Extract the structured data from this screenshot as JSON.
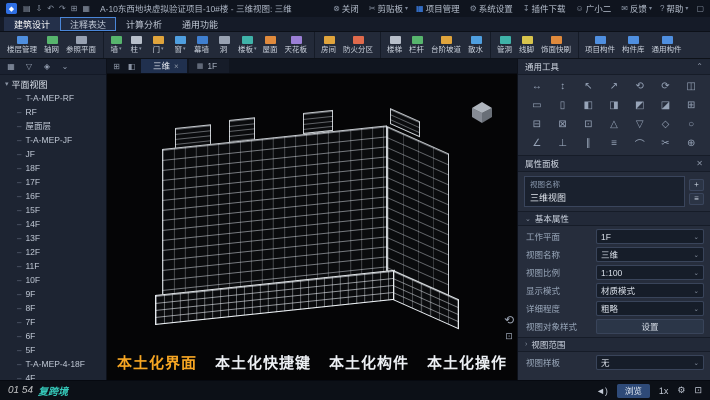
{
  "titlebar": {
    "logo_glyph": "◆",
    "quick_icons": [
      "▤",
      "⇩",
      "↶",
      "↷",
      "⊞",
      "▦"
    ],
    "title": "A-10东西地块虚拟验证项目-10#楼 - 三维视图: 三维",
    "right_items": [
      {
        "icon": "⊗",
        "label": "关闭",
        "arrow": ""
      },
      {
        "icon": "✂",
        "label": "剪贴板",
        "arrow": "▾"
      },
      {
        "icon": "▦",
        "label": "项目管理",
        "arrow": "",
        "icon_color": "#3f8cff"
      },
      {
        "icon": "⚙",
        "label": "系统设置",
        "arrow": ""
      },
      {
        "icon": "↧",
        "label": "插件下载",
        "arrow": ""
      },
      {
        "icon": "☺",
        "label": "广小二",
        "arrow": ""
      },
      {
        "icon": "✉",
        "label": "反馈",
        "arrow": "▾"
      },
      {
        "icon": "?",
        "label": "帮助",
        "arrow": "▾"
      }
    ],
    "window_glyph": "▢"
  },
  "menubar": {
    "tabs": [
      {
        "label": "建筑设计",
        "active": true
      },
      {
        "label": "注释表达",
        "hover": true
      },
      {
        "label": "计算分析"
      },
      {
        "label": "通用功能"
      }
    ]
  },
  "ribbon": {
    "tools": [
      {
        "label": "楼层管理",
        "color": "#4f8fe0"
      },
      {
        "label": "轴网",
        "color": "#57b56d"
      },
      {
        "label": "参照平面",
        "color": "#98a1b1"
      },
      {
        "label": "墙",
        "color": "#57b56d",
        "arrow": "▾",
        "sep": true
      },
      {
        "label": "柱",
        "color": "#b8bfca",
        "arrow": "▾"
      },
      {
        "label": "门",
        "color": "#e0a43c",
        "arrow": "▾"
      },
      {
        "label": "窗",
        "color": "#4f9fe0",
        "arrow": "▾"
      },
      {
        "label": "幕墙",
        "color": "#3f7fd0"
      },
      {
        "label": "洞",
        "color": "#98a1b1"
      },
      {
        "label": "楼板",
        "color": "#3fb3a9",
        "arrow": "▾"
      },
      {
        "label": "屋面",
        "color": "#e08a3c"
      },
      {
        "label": "天花板",
        "color": "#9b7fd6"
      },
      {
        "label": "房间",
        "color": "#e0a43c",
        "sep": true
      },
      {
        "label": "防火分区",
        "color": "#e06a4c"
      },
      {
        "label": "楼梯",
        "color": "#b8bfca",
        "sep": true
      },
      {
        "label": "栏杆",
        "color": "#57b56d"
      },
      {
        "label": "台阶坡道",
        "color": "#e0a43c"
      },
      {
        "label": "散水",
        "color": "#4f9fe0"
      },
      {
        "label": "管洞",
        "color": "#3fb3a9",
        "sep": true
      },
      {
        "label": "线脚",
        "color": "#d8c44c"
      },
      {
        "label": "饰面快刷",
        "color": "#e08a3c"
      },
      {
        "label": "项目构件",
        "color": "#4f8fe0",
        "sep": true
      },
      {
        "label": "构件库",
        "color": "#4f8fe0"
      },
      {
        "label": "通用构件",
        "color": "#4f8fe0"
      }
    ]
  },
  "left_panel": {
    "toolbar_icons": [
      "▦",
      "▽",
      "◈",
      "⌄"
    ],
    "tree_root": "平面视图",
    "root_caret": "▾",
    "items": [
      "T-A-MEP-RF",
      "RF",
      "屋面层",
      "T-A-MEP-JF",
      "JF",
      "18F",
      "17F",
      "16F",
      "15F",
      "14F",
      "13F",
      "12F",
      "11F",
      "10F",
      "9F",
      "8F",
      "7F",
      "6F",
      "5F",
      "T-A-MEP-4-18F",
      "4F"
    ]
  },
  "viewport": {
    "tab_icons": [
      "⊞",
      "◧"
    ],
    "tabs": [
      {
        "icon": "",
        "label": "三维",
        "close": "×",
        "active": true
      },
      {
        "icon": "▦",
        "label": "1F",
        "close": ""
      }
    ],
    "rotate_glyph": "⟲",
    "square_glyph": "⊡",
    "captions": [
      {
        "text": "本土化界面",
        "color": "#f7a623"
      },
      {
        "text": "本土化快捷键",
        "color": "#edf0f4"
      },
      {
        "text": "本土化构件",
        "color": "#edf0f4"
      },
      {
        "text": "本土化操作",
        "color": "#edf0f4"
      }
    ]
  },
  "right_panel": {
    "tools_title": "通用工具",
    "tools_header_icon": "⌃",
    "tool_icons": [
      "↔",
      "↕",
      "↖",
      "↗",
      "⟲",
      "⟳",
      "◫",
      "▭",
      "▯",
      "◧",
      "◨",
      "◩",
      "◪",
      "⊞",
      "⊟",
      "⊠",
      "⊡",
      "△",
      "▽",
      "◇",
      "○",
      "∠",
      "⊥",
      "∥",
      "≡",
      "⌒",
      "✂",
      "⊕"
    ],
    "properties_title": "属性面板",
    "properties_close_icon": "✕",
    "selector": {
      "line1": "视图名称",
      "line2": "三维视图",
      "add": "+",
      "list": "≡"
    },
    "basic_section": "基本属性",
    "basic_caret": "⌄",
    "rows": [
      {
        "label": "工作平面",
        "value": "1F",
        "arrow": "⌄"
      },
      {
        "label": "视图名称",
        "value": "三维",
        "arrow": "⌄"
      },
      {
        "label": "视图比例",
        "value": "1:100",
        "arrow": "⌄"
      },
      {
        "label": "显示模式",
        "value": "材质模式",
        "arrow": "⌄"
      },
      {
        "label": "详细程度",
        "value": "粗略",
        "arrow": "⌄"
      },
      {
        "label": "视图对象样式",
        "value": "设置",
        "arrow": "",
        "button": true
      }
    ],
    "range_section": "视图范围",
    "range_caret": "›",
    "template_row": {
      "label": "视图样板",
      "value": "无",
      "arrow": "⌄"
    }
  },
  "statusbar": {
    "watermark_time": "01 54",
    "watermark_brand": "复跨境",
    "volume_glyph": "◄)",
    "browse_label": "浏览",
    "speed_label": "1x",
    "settings_glyph": "⚙",
    "fullscreen_glyph": "⊡"
  }
}
